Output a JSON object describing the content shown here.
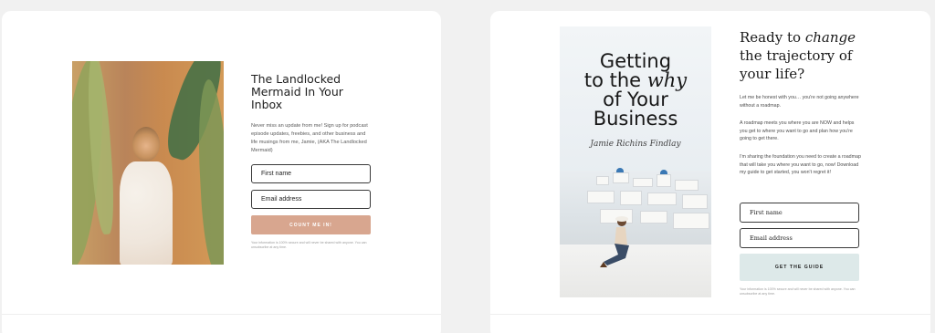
{
  "left_card": {
    "title": "The Landlocked Mermaid In Your Inbox",
    "lead": "Never miss an update from me! Sign up for podcast episode updates, freebies, and other business and life musings from me, Jamie, (AKA The Landlocked Mermaid)",
    "first_name_placeholder": "First name",
    "email_placeholder": "Email address",
    "button_label": "COUNT ME IN!",
    "disclaimer": "Your information is 100% secure and will never be shared with anyone. You can unsubscribe at any time."
  },
  "right_card": {
    "cover": {
      "title_line1": "Getting",
      "title_line2_pre": "to the",
      "title_line2_emph": "why",
      "title_line3": "of Your",
      "title_line4": "Business",
      "author": "Jamie Richins Findlay"
    },
    "heading_pre": "Ready to",
    "heading_emph": "change",
    "heading_post": "the trajectory of your life?",
    "para1": "Let me be honest with you… you're not going anywhere without a roadmap.",
    "para2": "A roadmap meets you where you are NOW and helps you get to where you want to go and plan how you're going to get there.",
    "para3": "I'm sharing the foundation you need to create a roadmap that will take you where you want to go, now! Download my guide to get started, you won't regret it!",
    "first_name_placeholder": "First name",
    "email_placeholder": "Email address",
    "button_label": "GET THE GUIDE",
    "disclaimer": "Your information is 100% secure and will never be shared with anyone. You can unsubscribe at any time."
  },
  "colors": {
    "left_button": "#d8a68f",
    "right_button": "#dde9e9",
    "card_background": "#ffffff",
    "page_background": "#f1f1f1"
  }
}
